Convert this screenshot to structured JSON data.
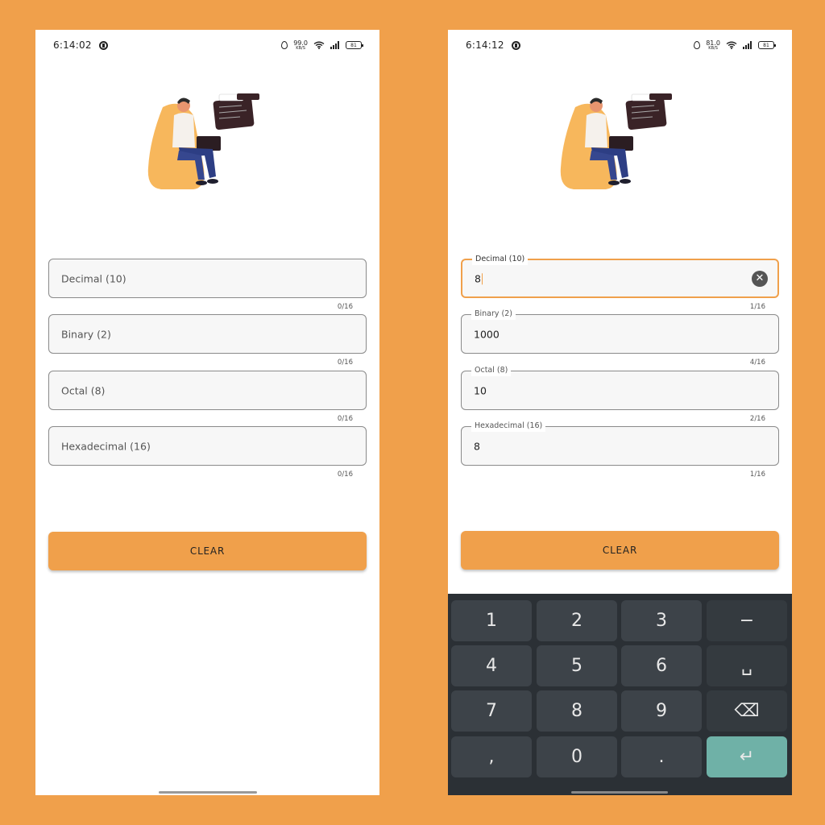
{
  "colors": {
    "background": "#F0A04B",
    "accent": "#F0A04B",
    "keyboard_bg": "#2b3035",
    "enter_key": "#6fb1a7"
  },
  "left": {
    "status": {
      "time": "6:14:02",
      "net_speed": "99.0",
      "net_unit": "KB/S",
      "battery": "81"
    },
    "fields": [
      {
        "placeholder": "Decimal (10)",
        "counter": "0/16"
      },
      {
        "placeholder": "Binary (2)",
        "counter": "0/16"
      },
      {
        "placeholder": "Octal (8)",
        "counter": "0/16"
      },
      {
        "placeholder": "Hexadecimal (16)",
        "counter": "0/16"
      }
    ],
    "clear_label": "CLEAR"
  },
  "right": {
    "status": {
      "time": "6:14:12",
      "net_speed": "81.0",
      "net_unit": "KB/S",
      "battery": "81"
    },
    "fields": [
      {
        "label": "Decimal (10)",
        "value": "8",
        "counter": "1/16",
        "focused": true
      },
      {
        "label": "Binary (2)",
        "value": "1000",
        "counter": "4/16"
      },
      {
        "label": "Octal (8)",
        "value": "10",
        "counter": "2/16"
      },
      {
        "label": "Hexadecimal (16)",
        "value": "8",
        "counter": "1/16"
      }
    ],
    "clear_label": "CLEAR",
    "keyboard": {
      "keys": [
        "1",
        "2",
        "3",
        "−",
        "4",
        "5",
        "6",
        "␣",
        "7",
        "8",
        "9",
        "⌫",
        ",",
        "0",
        ".",
        "↵"
      ]
    }
  }
}
